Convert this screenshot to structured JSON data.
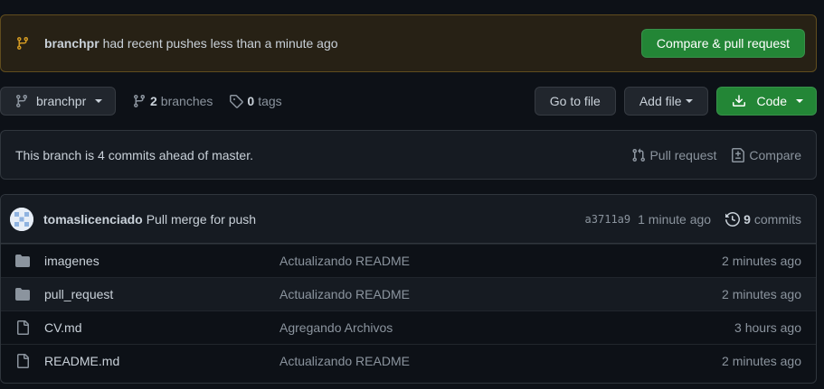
{
  "push_banner": {
    "branch": "branchpr",
    "message": "had recent pushes less than a minute ago",
    "compare_button": "Compare & pull request"
  },
  "toolbar": {
    "branch_select": "branchpr",
    "branches_count": "2",
    "branches_label": "branches",
    "tags_count": "0",
    "tags_label": "tags",
    "go_to_file": "Go to file",
    "add_file": "Add file",
    "code": "Code"
  },
  "ahead": {
    "text": "This branch is 4 commits ahead of master.",
    "pull_request": "Pull request",
    "compare": "Compare"
  },
  "latest_commit": {
    "author": "tomaslicenciado",
    "message": "Pull merge for push",
    "sha": "a3711a9",
    "time": "1 minute ago",
    "commits_count": "9",
    "commits_label": "commits"
  },
  "files": [
    {
      "name": "imagenes",
      "type": "folder",
      "message": "Actualizando README",
      "age": "2 minutes ago"
    },
    {
      "name": "pull_request",
      "type": "folder",
      "message": "Actualizando README",
      "age": "2 minutes ago"
    },
    {
      "name": "CV.md",
      "type": "file",
      "message": "Agregando Archivos",
      "age": "3 hours ago"
    },
    {
      "name": "README.md",
      "type": "file",
      "message": "Actualizando README",
      "age": "2 minutes ago"
    }
  ],
  "colors": {
    "background": "#0d1117",
    "banner_bg": "#272115",
    "banner_icon": "#d29922",
    "primary_button": "#238636",
    "muted_text": "#8b949e",
    "border": "#30363d"
  },
  "icons": {
    "banner": "git-branch-icon",
    "branch_select": "git-branch-icon",
    "branches": "git-branch-icon",
    "tags": "tag-icon",
    "code": "download-icon",
    "pull_request": "git-pull-request-icon",
    "compare": "file-diff-icon",
    "history": "history-icon",
    "folder": "folder-icon",
    "file": "file-icon"
  }
}
